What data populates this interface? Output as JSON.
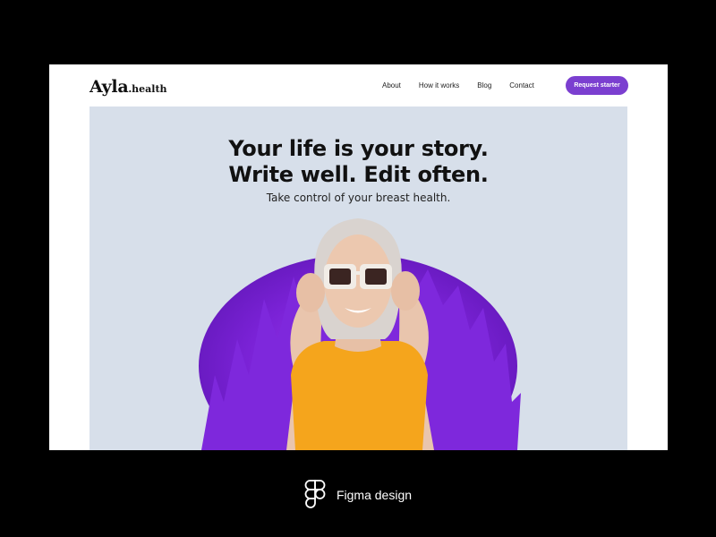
{
  "brand": {
    "name": "Ayla",
    "suffix": ".health"
  },
  "nav": [
    {
      "label": "About"
    },
    {
      "label": "How it works"
    },
    {
      "label": "Blog"
    },
    {
      "label": "Contact"
    }
  ],
  "cta": {
    "label": "Request starter"
  },
  "hero": {
    "headline_line1": "Your life is your story.",
    "headline_line2": "Write well. Edit often.",
    "subheading": "Take control of your breast health."
  },
  "caption": {
    "text": "Figma design",
    "icon": "figma-icon"
  },
  "colors": {
    "accent": "#7b3fd0",
    "hero_bg": "#d7dfea",
    "shirt": "#f5a51c",
    "fur": "#8a2be2"
  }
}
